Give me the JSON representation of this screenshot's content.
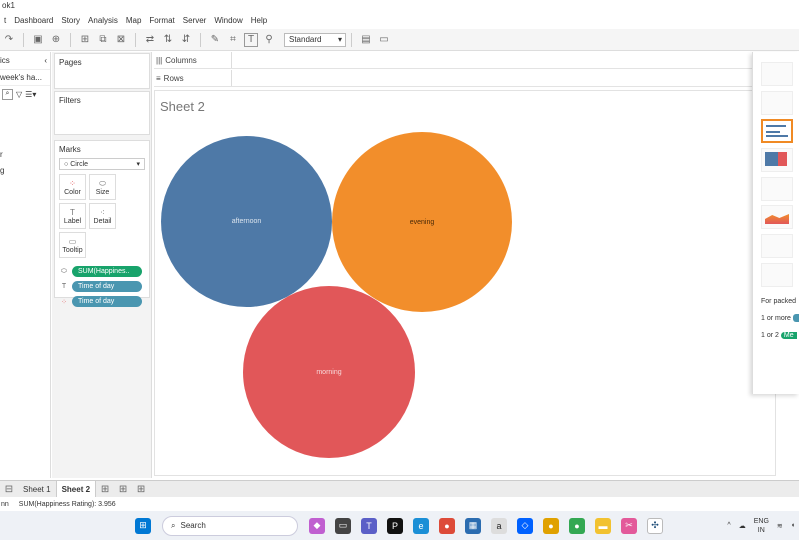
{
  "window": {
    "title": "ok1"
  },
  "menu": [
    "t",
    "Dashboard",
    "Story",
    "Analysis",
    "Map",
    "Format",
    "Server",
    "Window",
    "Help"
  ],
  "toolbar": {
    "fit_select": "Standard"
  },
  "data_pane": {
    "header": "ics",
    "source": "week's ha...",
    "dim_fragment": "r",
    "measure_fragment": "g"
  },
  "shelves": {
    "pages": "Pages",
    "filters": "Filters",
    "marks": "Marks",
    "columns": "Columns",
    "rows": "Rows"
  },
  "marks_card": {
    "type": "Circle",
    "buttons": [
      "Color",
      "Size",
      "Label",
      "Detail",
      "Tooltip"
    ],
    "pills": [
      "SUM(Happines..",
      "Time of day",
      "Time of day"
    ]
  },
  "sheet": {
    "title": "Sheet 2"
  },
  "chart_data": {
    "type": "packed-bubbles",
    "categories": [
      "afternoon",
      "evening",
      "morning"
    ],
    "colors": [
      "#4e79a7",
      "#f28e2b",
      "#e15759"
    ],
    "size_measure": "SUM(Happiness Rating)"
  },
  "show_me": {
    "text_lines": [
      "For packed",
      "1 or more",
      "1 or 2",
      "Me"
    ]
  },
  "tabs": {
    "left": "Sheet 1",
    "active": "Sheet 2"
  },
  "status": {
    "left": "nn",
    "summary": "SUM(Happiness Rating): 3.956"
  },
  "taskbar": {
    "search": "Search",
    "lang": "ENG",
    "region": "IN"
  }
}
